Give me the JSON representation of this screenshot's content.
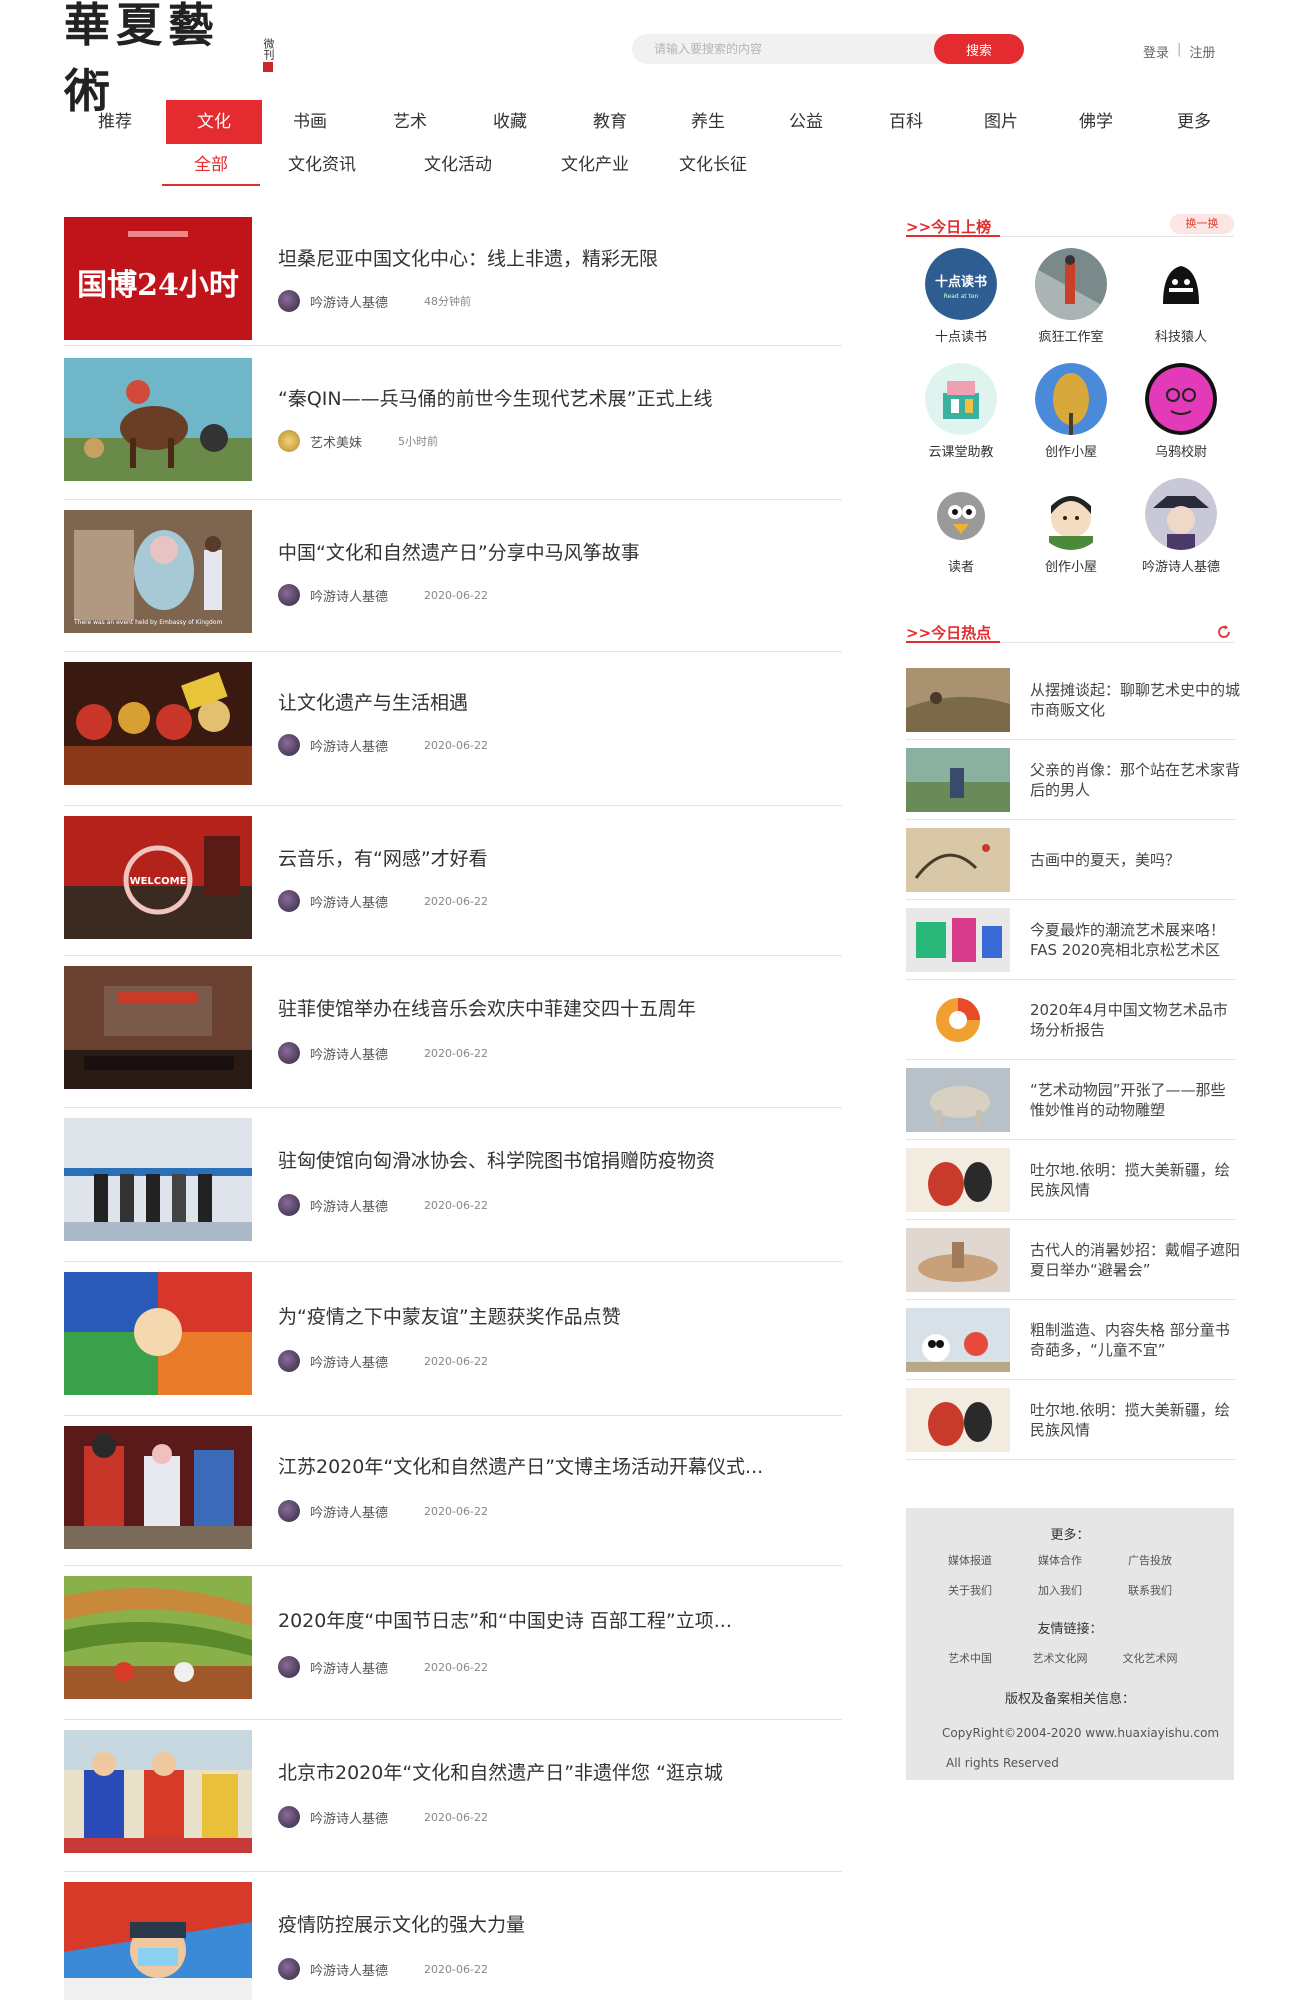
{
  "header": {
    "logo_text": "華夏藝術",
    "logo_seal": "微刊",
    "search_placeholder": "请输入要搜索的内容",
    "search_button": "搜索",
    "login": "登录",
    "separator": "|",
    "register": "注册"
  },
  "nav": [
    "推荐",
    "文化",
    "书画",
    "艺术",
    "收藏",
    "教育",
    "养生",
    "公益",
    "百科",
    "图片",
    "佛学",
    "更多"
  ],
  "nav_active": "文化",
  "subnav": [
    "全部",
    "文化资讯",
    "文化活动",
    "文化产业",
    "文化长征"
  ],
  "subnav_active": "全部",
  "articles": [
    {
      "title": "坦桑尼亚中国文化中心：线上非遗，精彩无限",
      "author": "吟游诗人基德",
      "time": "48分钟前",
      "thumb_text": "国博24小时"
    },
    {
      "title": "“秦QIN——兵马俑的前世今生现代艺术展”正式上线",
      "author": "艺术美妹",
      "time": "5小时前"
    },
    {
      "title": "中国“文化和自然遗产日”分享中马风筝故事",
      "author": "吟游诗人基德",
      "time": "2020-06-22",
      "thumb_text": "There was an event held by Embassy of Kingdom"
    },
    {
      "title": "让文化遗产与生活相遇",
      "author": "吟游诗人基德",
      "time": "2020-06-22"
    },
    {
      "title": "云音乐，有“网感”才好看",
      "author": "吟游诗人基德",
      "time": "2020-06-22",
      "thumb_text": "WELCOME"
    },
    {
      "title": "驻菲使馆举办在线音乐会欢庆中菲建交四十五周年",
      "author": "吟游诗人基德",
      "time": "2020-06-22"
    },
    {
      "title": "驻匈使馆向匈滑冰协会、科学院图书馆捐赠防疫物资",
      "author": "吟游诗人基德",
      "time": "2020-06-22"
    },
    {
      "title": "为“疫情之下中蒙友谊”主题获奖作品点赞",
      "author": "吟游诗人基德",
      "time": "2020-06-22"
    },
    {
      "title": "江苏2020年“文化和自然遗产日”文博主场活动开幕仪式...",
      "author": "吟游诗人基德",
      "time": "2020-06-22"
    },
    {
      "title": "2020年度“中国节日志”和“中国史诗 百部工程”立项...",
      "author": "吟游诗人基德",
      "time": "2020-06-22"
    },
    {
      "title": "北京市2020年“文化和自然遗产日”非遗伴您 “逛京城",
      "author": "吟游诗人基德",
      "time": "2020-06-22"
    },
    {
      "title": "疫情防控展示文化的强大力量",
      "author": "吟游诗人基德",
      "time": "2020-06-22"
    }
  ],
  "sidebar": {
    "ranking_title": ">>今日上榜",
    "swap_button": "换一换",
    "authors": [
      {
        "name": "十点读书",
        "logo_text": "十点读书",
        "logo_sub": "Read at ten"
      },
      {
        "name": "疯狂工作室"
      },
      {
        "name": "科技猿人"
      },
      {
        "name": "云课堂助教"
      },
      {
        "name": "创作小屋"
      },
      {
        "name": "乌鸦校尉"
      },
      {
        "name": "读者"
      },
      {
        "name": "创作小屋"
      },
      {
        "name": "吟游诗人基德"
      }
    ],
    "hot_title": ">>今日热点",
    "hot": [
      "从摆摊谈起：聊聊艺术史中的城市商贩文化",
      "父亲的肖像：那个站在艺术家背后的男人",
      "古画中的夏天，美吗？",
      "今夏最炸的潮流艺术展来咯！FAS 2020亮相北京松艺术区",
      "2020年4月中国文物艺术品市场分析报告",
      "“艺术动物园”开张了——那些惟妙惟肖的动物雕塑",
      "吐尔地.依明：揽大美新疆，绘民族风情",
      "古代人的消暑妙招：戴帽子遮阳 夏日举办“避暑会”",
      "粗制滥造、内容失格 部分童书奇葩多，“儿童不宜”",
      "吐尔地.依明：揽大美新疆，绘民族风情"
    ],
    "footer": {
      "more_title": "更多：",
      "more_row1": [
        "媒体报道",
        "媒体合作",
        "广告投放"
      ],
      "more_row2": [
        "关于我们",
        "加入我们",
        "联系我们"
      ],
      "links_title": "友情链接：",
      "links": [
        "艺术中国",
        "艺术文化网",
        "文化艺术网"
      ],
      "copyright_title": "版权及备案相关信息：",
      "copyright": "CopyRight©2004-2020 www.huaxiayishu.com",
      "rights": "All rights Reserved"
    }
  },
  "colors": {
    "accent": "#e42b2f",
    "divider": "#e3e3e3",
    "footer_bg": "#e6e6e6"
  }
}
